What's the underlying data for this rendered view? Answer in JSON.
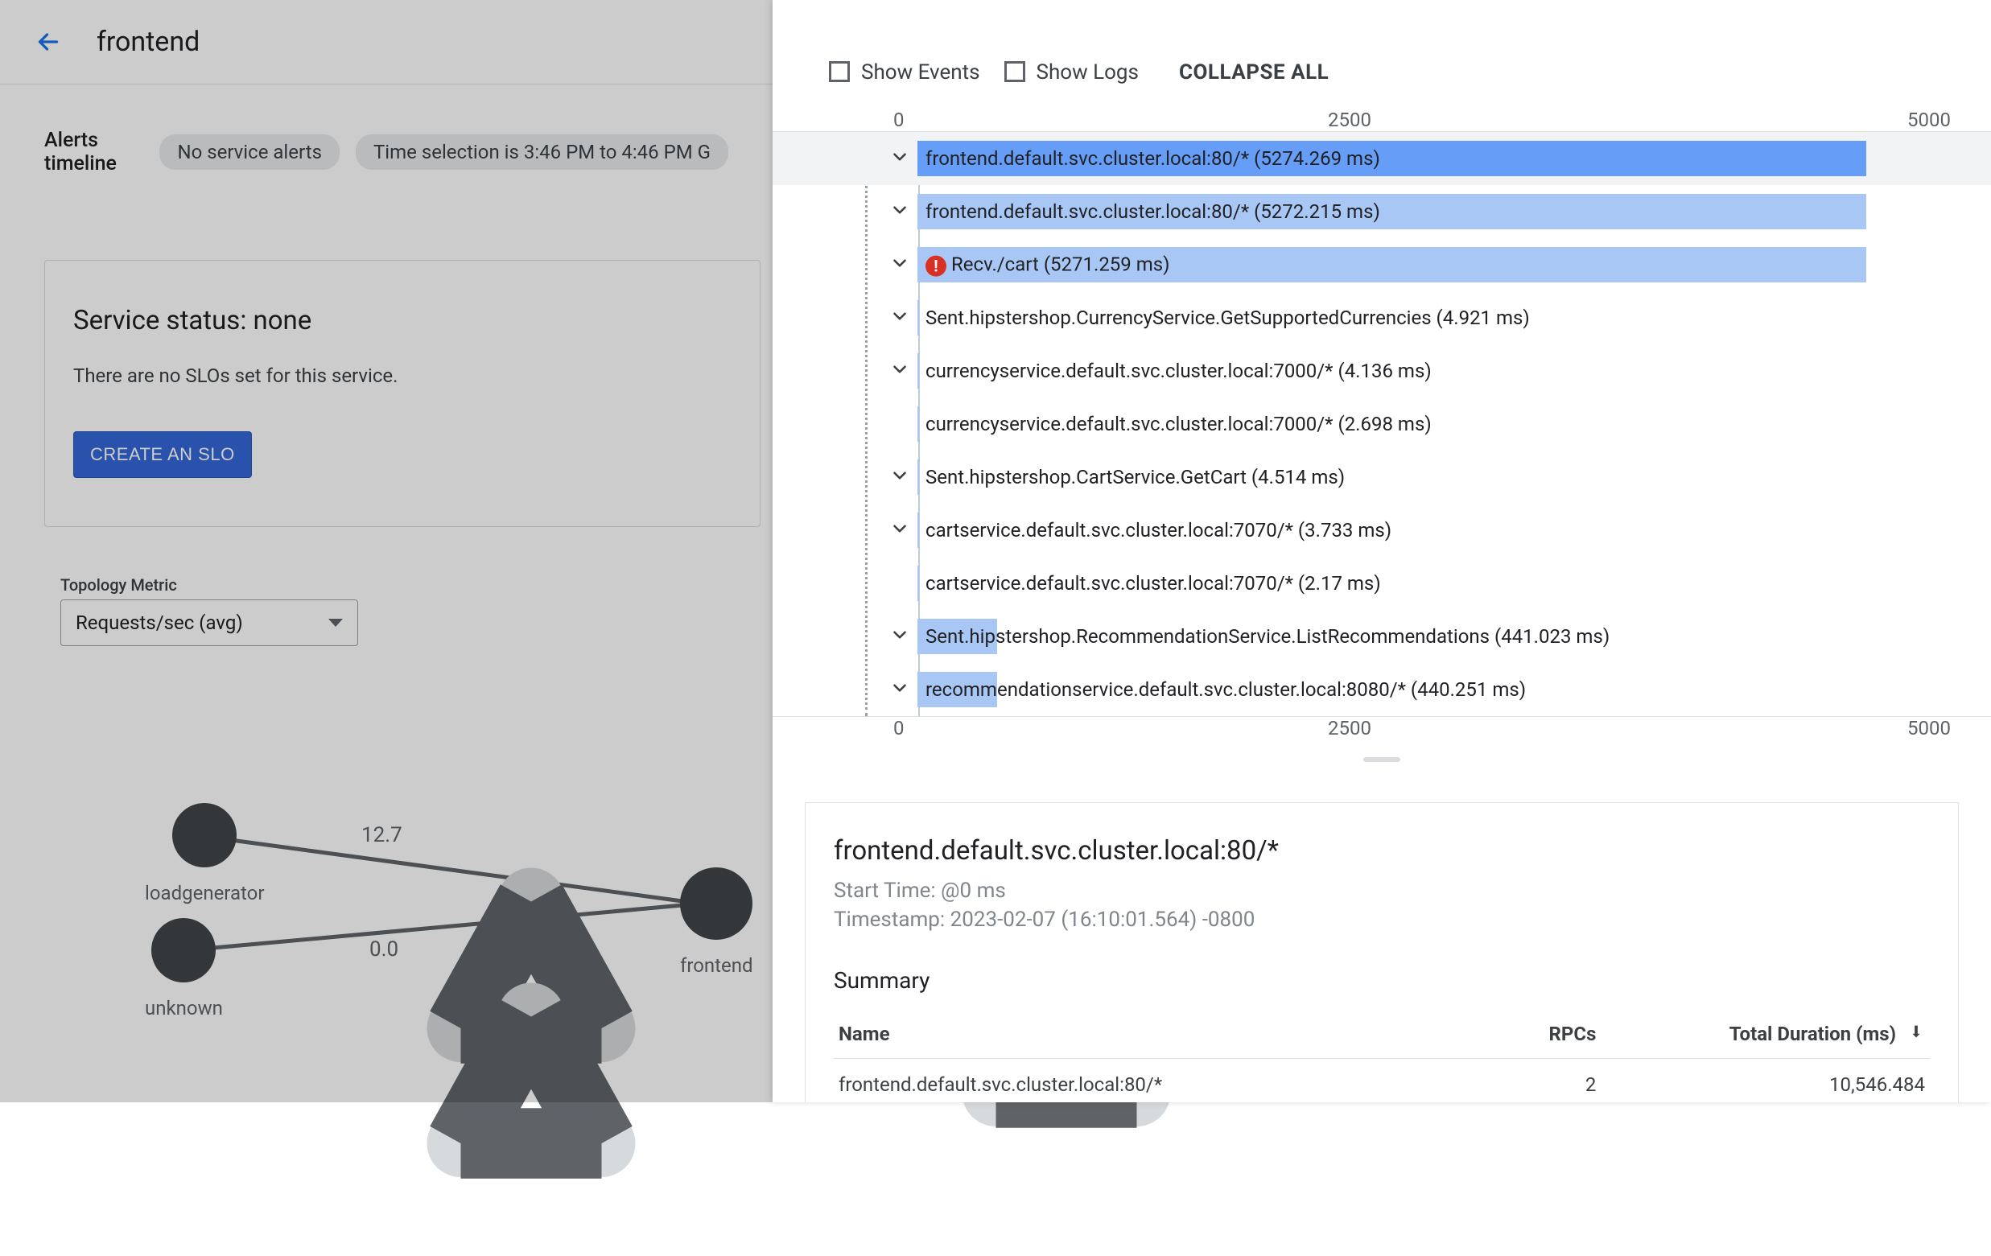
{
  "header": {
    "page_title": "frontend"
  },
  "alerts": {
    "section_label": "Alerts timeline",
    "no_alerts_chip": "No service alerts",
    "time_selection_chip": "Time selection is 3:46 PM to 4:46 PM G"
  },
  "status_card": {
    "title": "Service status: none",
    "body": "There are no SLOs set for this service.",
    "button": "CREATE AN SLO"
  },
  "topology_metric": {
    "label": "Topology Metric",
    "selected": "Requests/sec (avg)"
  },
  "topology": {
    "nodes": {
      "loadgenerator": "loadgenerator",
      "unknown": "unknown",
      "frontend": "frontend"
    },
    "edges": {
      "loadgen_to_frontend": "12.7",
      "unknown_to_frontend": "0.0"
    }
  },
  "trace": {
    "controls": {
      "show_events": "Show Events",
      "show_logs": "Show Logs",
      "collapse_all": "COLLAPSE ALL"
    },
    "axis": {
      "t0": "0",
      "t1": "2500",
      "t2": "5000"
    },
    "spans": [
      {
        "label": "frontend.default.svc.cluster.local:80/* (5274.269 ms)",
        "indent": 0,
        "bar_start": 0,
        "bar_width": 1,
        "dark": true,
        "chev": true,
        "error": false,
        "selected": true
      },
      {
        "label": "frontend.default.svc.cluster.local:80/* (5272.215 ms)",
        "indent": 0,
        "bar_start": 0,
        "bar_width": 1,
        "dark": false,
        "chev": true,
        "error": false
      },
      {
        "label": "Recv./cart (5271.259 ms)",
        "indent": 0,
        "bar_start": 0,
        "bar_width": 1,
        "dark": false,
        "chev": true,
        "error": true
      },
      {
        "label": "Sent.hipstershop.CurrencyService.GetSupportedCurrencies (4.921 ms)",
        "indent": 0,
        "bar_start": 0,
        "bar_width": 0.002,
        "dark": false,
        "chev": true,
        "error": false
      },
      {
        "label": "currencyservice.default.svc.cluster.local:7000/* (4.136 ms)",
        "indent": 0,
        "bar_start": 0,
        "bar_width": 0.002,
        "dark": false,
        "chev": true,
        "error": false
      },
      {
        "label": "currencyservice.default.svc.cluster.local:7000/* (2.698 ms)",
        "indent": 0,
        "bar_start": 0,
        "bar_width": 0.001,
        "dark": false,
        "chev": false,
        "error": false
      },
      {
        "label": "Sent.hipstershop.CartService.GetCart (4.514 ms)",
        "indent": 0,
        "bar_start": 0,
        "bar_width": 0.002,
        "dark": false,
        "chev": true,
        "error": false
      },
      {
        "label": "cartservice.default.svc.cluster.local:7070/* (3.733 ms)",
        "indent": 0,
        "bar_start": 0,
        "bar_width": 0.002,
        "dark": false,
        "chev": true,
        "error": false
      },
      {
        "label": "cartservice.default.svc.cluster.local:7070/* (2.17 ms)",
        "indent": 0,
        "bar_start": 0,
        "bar_width": 0.001,
        "dark": false,
        "chev": false,
        "error": false
      },
      {
        "label": "Sent.hipstershop.RecommendationService.ListRecommendations (441.023 ms)",
        "indent": 0,
        "bar_start": 0,
        "bar_width": 0.084,
        "dark": false,
        "chev": true,
        "error": false
      },
      {
        "label": "recommendationservice.default.svc.cluster.local:8080/* (440.251 ms)",
        "indent": 0,
        "bar_start": 0,
        "bar_width": 0.084,
        "dark": false,
        "chev": true,
        "error": false
      }
    ],
    "details": {
      "title": "frontend.default.svc.cluster.local:80/*",
      "start_time_label": "Start Time: ",
      "start_time": "@0 ms",
      "timestamp_label": "Timestamp: ",
      "timestamp": "2023-02-07 (16:10:01.564) -0800",
      "summary_label": "Summary",
      "columns": {
        "name": "Name",
        "rpcs": "RPCs",
        "duration": "Total Duration (ms)"
      },
      "rows": [
        {
          "name": "frontend.default.svc.cluster.local:80/*",
          "rpcs": "2",
          "duration": "10,546.484"
        }
      ]
    }
  }
}
